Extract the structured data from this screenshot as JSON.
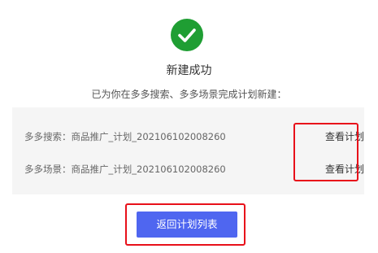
{
  "result": {
    "icon": "check-circle-icon",
    "icon_color": "#1f9e33",
    "title": "新建成功",
    "subtitle": "已为你在多多搜索、多多场景完成计划新建："
  },
  "plans": [
    {
      "label": "多多搜索：商品推广_计划_202106102008260",
      "link": "查看计划"
    },
    {
      "label": "多多场景：商品推广_计划_202106102008260",
      "link": "查看计划"
    }
  ],
  "actions": {
    "return_label": "返回计划列表",
    "button_color": "#4f66f0"
  },
  "annotation_color": "#e8101a"
}
